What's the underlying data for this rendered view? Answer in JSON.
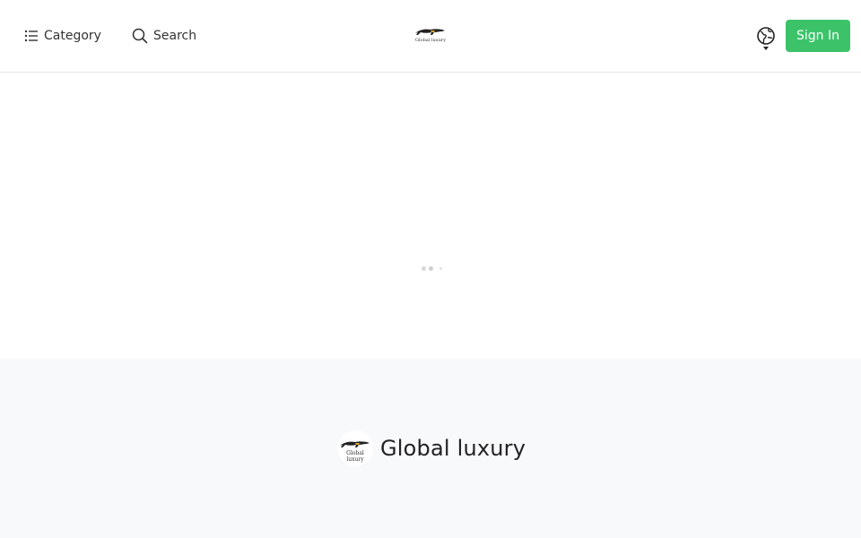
{
  "header": {
    "category_label": "Category",
    "search_label": "Search",
    "logo_text": "Global luxury",
    "signin_label": "Sign In",
    "icons": {
      "category": "list-icon",
      "search": "search-icon",
      "language": "globe-icon"
    },
    "colors": {
      "signin_bg": "#3cc36a"
    }
  },
  "footer": {
    "brand_name": "Global luxury",
    "logo_text": "Global luxury"
  }
}
